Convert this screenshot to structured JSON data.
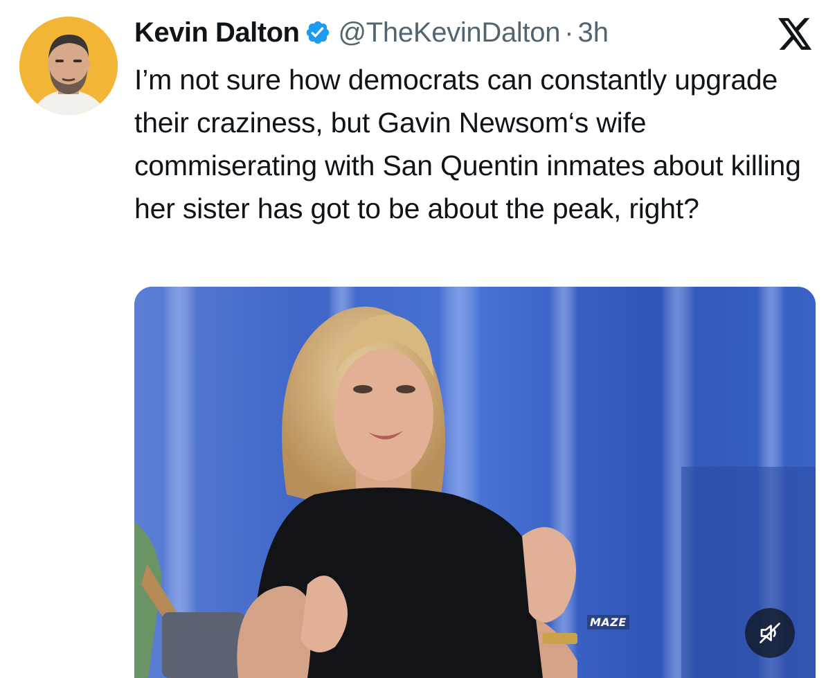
{
  "tweet": {
    "author": {
      "display_name": "Kevin Dalton",
      "handle": "@TheKevinDalton",
      "verified": true,
      "avatar_icon": "avatar-photo"
    },
    "separator": "·",
    "timestamp": "3h",
    "text": "I’m not sure how democrats can constantly upgrade their craziness, but Gavin Newsom‘s wife commiserating with San Quentin inmates about killing her sister has got to be about the peak, right?",
    "media": {
      "type": "video",
      "watermark": "MAZE",
      "mute_icon": "speaker-muted-icon"
    }
  },
  "brand": {
    "logo_icon": "x-logo-icon"
  },
  "colors": {
    "text_primary": "#0f1419",
    "text_secondary": "#536471",
    "verified_blue": "#1d9bf0",
    "avatar_bg": "#f2b536",
    "curtain_blue": "#3a62c4"
  }
}
